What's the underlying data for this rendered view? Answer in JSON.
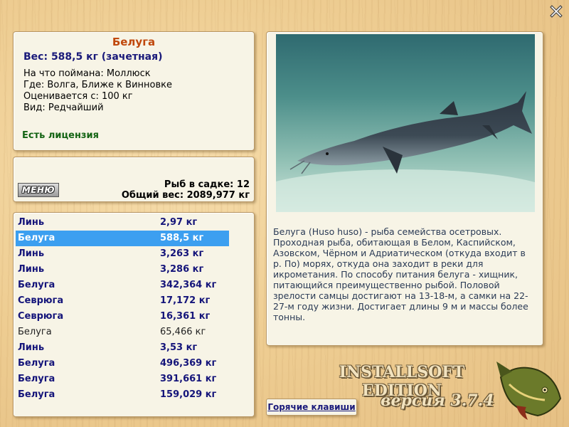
{
  "info": {
    "name": "Белуга",
    "weight": "Вес: 588,5 кг (зачетная)",
    "bait": "На что поймана: Моллюск",
    "location": "Где: Волга, Ближе к Винновке",
    "value": "Оценивается с: 100 кг",
    "kind": "Вид: Редчайший",
    "license": "Есть лицензия"
  },
  "stats": {
    "menu_label": "МЕНЮ",
    "fish_count": "Рыб в садке: 12",
    "total_weight": "Общий вес: 2089,977 кг"
  },
  "catch_list": [
    {
      "name": "Линь",
      "weight": "2,97 кг",
      "style": "bold"
    },
    {
      "name": "Белуга",
      "weight": "588,5 кг",
      "style": "selected"
    },
    {
      "name": "Линь",
      "weight": "3,263 кг",
      "style": "bold"
    },
    {
      "name": "Линь",
      "weight": "3,286 кг",
      "style": "bold"
    },
    {
      "name": "Белуга",
      "weight": "342,364 кг",
      "style": "bold"
    },
    {
      "name": "Севрюга",
      "weight": "17,172 кг",
      "style": "bold"
    },
    {
      "name": "Севрюга",
      "weight": "16,361 кг",
      "style": "bold"
    },
    {
      "name": "Белуга",
      "weight": "65,466 кг",
      "style": "plain"
    },
    {
      "name": "Линь",
      "weight": "3,53 кг",
      "style": "bold"
    },
    {
      "name": "Белуга",
      "weight": "496,369 кг",
      "style": "bold"
    },
    {
      "name": "Белуга",
      "weight": "391,661 кг",
      "style": "bold"
    },
    {
      "name": "Белуга",
      "weight": "159,029 кг",
      "style": "bold"
    }
  ],
  "description": "Белуга (Huso huso) - рыба семейства осетровых. Проходная рыба, обитающая в Белом, Каспийском, Азовском, Чёрном и Адриатическом (откуда входит в р. По) морях, откуда она заходит в реки для икрометания. По способу питания белуга - хищник, питающийся преимущественно рыбой. Половой зрелости самцы достигают на 13-18-м, а самки на 22-27-м году жизни. Достигает длины 9 м и массы более тонны.",
  "hotkeys_label": "Горячие клавиши",
  "brand": "INSTALLSOFT EDITION",
  "version": "версия 3.7.4",
  "icons": {
    "close": "close-icon",
    "photo": "beluga-fish-photo",
    "logo": "pike-logo"
  },
  "colors": {
    "title": "#c0480c",
    "accent_text": "#15157a",
    "license": "#146414",
    "selection": "#3c9ff0"
  }
}
